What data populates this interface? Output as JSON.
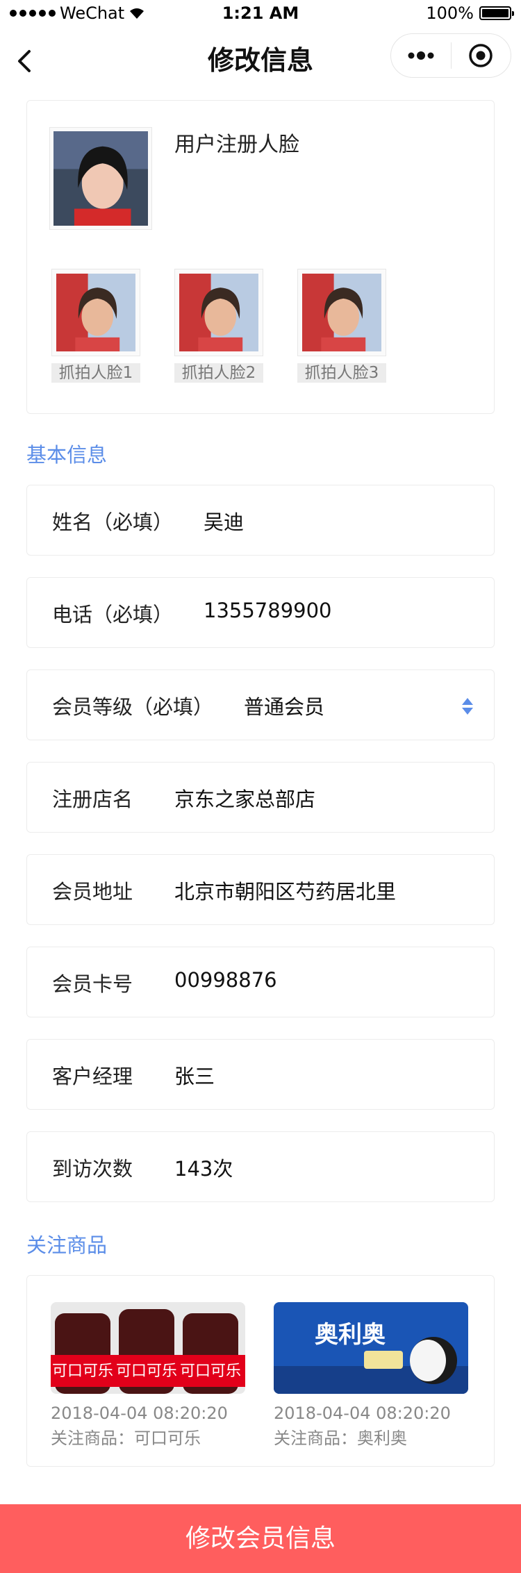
{
  "status_bar": {
    "carrier": "WeChat",
    "time": "1:21 AM",
    "battery": "100%"
  },
  "nav": {
    "title": "修改信息"
  },
  "faces": {
    "registered_label": "用户注册人脸",
    "snaps": [
      "抓拍人脸1",
      "抓拍人脸2",
      "抓拍人脸3"
    ]
  },
  "basic_section": {
    "title": "基本信息"
  },
  "fields": {
    "name": {
      "label": "姓名（必填）",
      "value": "吴迪"
    },
    "phone": {
      "label": "电话（必填）",
      "value": "1355789900"
    },
    "level": {
      "label": "会员等级（必填）",
      "value": "普通会员"
    },
    "store": {
      "label": "注册店名",
      "value": "京东之家总部店"
    },
    "address": {
      "label": "会员地址",
      "value": "北京市朝阳区芍药居北里"
    },
    "card_no": {
      "label": "会员卡号",
      "value": "00998876"
    },
    "manager": {
      "label": "客户经理",
      "value": "张三"
    },
    "visits": {
      "label": "到访次数",
      "value": "143次"
    }
  },
  "follow_section": {
    "title": "关注商品"
  },
  "products": [
    {
      "time": "2018-04-04 08:20:20",
      "name": "关注商品：可口可乐",
      "image_text": "可口可乐"
    },
    {
      "time": "2018-04-04 08:20:20",
      "name": "关注商品：奥利奥",
      "image_text": "奥利奥"
    }
  ],
  "submit": {
    "label": "修改会员信息"
  },
  "colors": {
    "accent": "#5b8de8",
    "button": "#ff5e5e"
  }
}
